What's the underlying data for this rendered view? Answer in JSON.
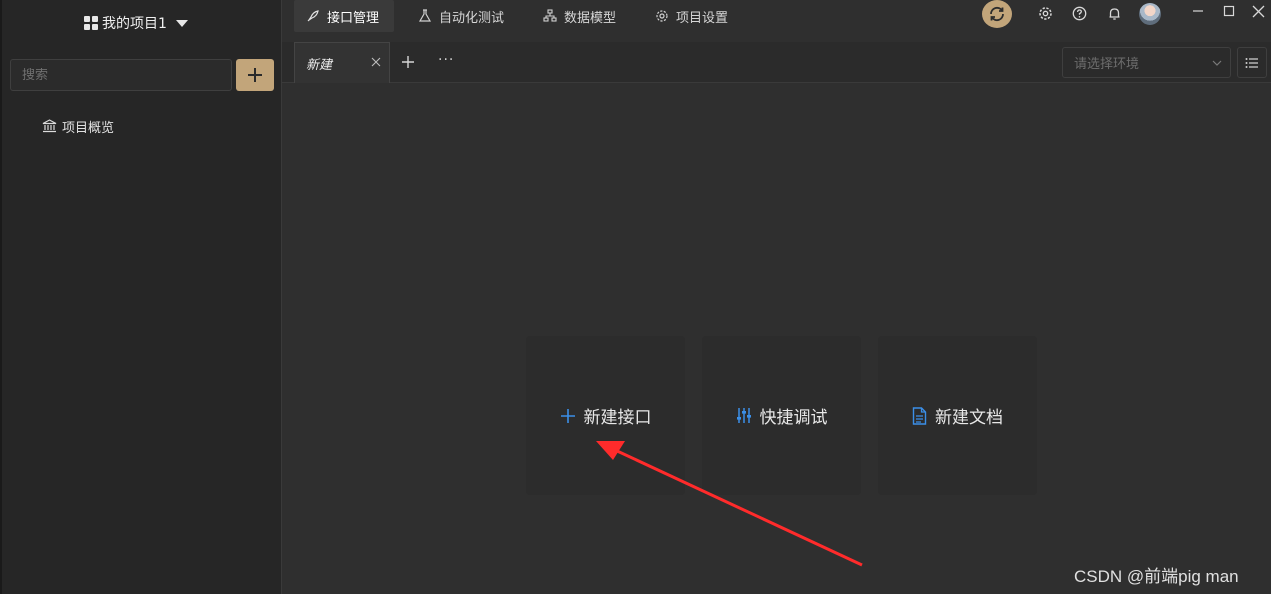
{
  "sidebar": {
    "project_name": "我的项目1",
    "search_placeholder": "搜索",
    "nav_items": [
      {
        "label": "项目概览",
        "icon": "bank-icon"
      }
    ]
  },
  "topnav": {
    "items": [
      {
        "label": "接口管理",
        "icon": "rocket-icon",
        "active": true
      },
      {
        "label": "自动化测试",
        "icon": "flask-icon",
        "active": false
      },
      {
        "label": "数据模型",
        "icon": "hierarchy-icon",
        "active": false
      },
      {
        "label": "项目设置",
        "icon": "gear-icon",
        "active": false
      }
    ],
    "right_icons": [
      "sync-icon",
      "gear-icon",
      "help-icon",
      "bell-icon",
      "avatar",
      "minimize-icon",
      "maximize-icon",
      "close-icon"
    ]
  },
  "tabs": {
    "items": [
      {
        "label": "新建",
        "active": true
      }
    ],
    "more": "···",
    "env_placeholder": "请选择环境"
  },
  "cards": [
    {
      "label": "新建接口",
      "icon": "plus-icon"
    },
    {
      "label": "快捷调试",
      "icon": "sliders-icon"
    },
    {
      "label": "新建文档",
      "icon": "document-icon"
    }
  ],
  "watermark": "CSDN @前端pig man",
  "colors": {
    "accent_gold": "#c2a57a",
    "card_icon_blue": "#3b8fe8",
    "annotation_arrow": "#ff2b2b"
  }
}
